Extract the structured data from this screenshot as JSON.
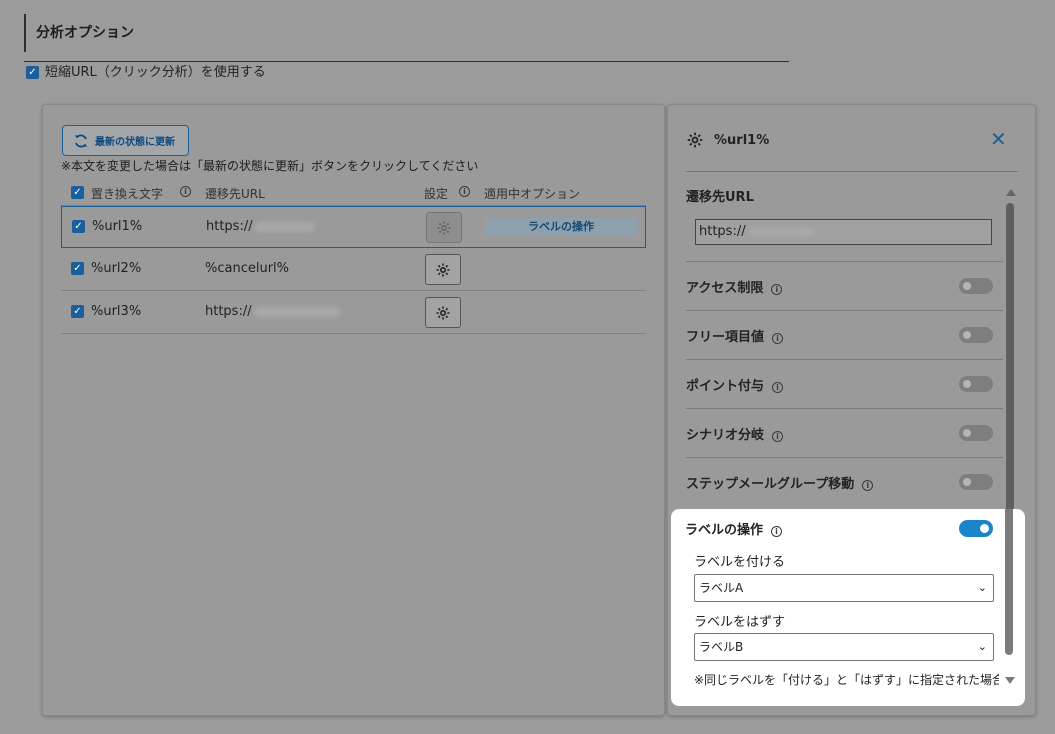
{
  "section": {
    "title": "分析オプション"
  },
  "short_url": {
    "label": "短縮URL（クリック分析）を使用する",
    "checked": true
  },
  "left_panel": {
    "refresh_label": "最新の状態に更新",
    "note": "※本文を変更した場合は「最新の状態に更新」ボタンをクリックしてください",
    "columns": {
      "var": "置き換え文字",
      "dest": "遷移先URL",
      "settings": "設定",
      "options": "適用中オプション"
    },
    "rows": [
      {
        "var": "%url1%",
        "url": "https://",
        "option": "ラベルの操作"
      },
      {
        "var": "%url2%",
        "url": "%cancelurl%",
        "option": ""
      },
      {
        "var": "%url3%",
        "url": "https://",
        "option": ""
      }
    ]
  },
  "right_panel": {
    "title": "%url1%",
    "close": "✕",
    "dest_label": "遷移先URL",
    "dest_value": "https://",
    "options": [
      {
        "label": "アクセス制限",
        "enabled": false
      },
      {
        "label": "フリー項目値",
        "enabled": false
      },
      {
        "label": "ポイント付与",
        "enabled": false
      },
      {
        "label": "シナリオ分岐",
        "enabled": false
      },
      {
        "label": "ステップメールグループ移動",
        "enabled": false
      }
    ],
    "label_op": {
      "label": "ラベルの操作",
      "enabled": true,
      "add_label": "ラベルを付ける",
      "add_value": "ラベルA",
      "remove_label": "ラベルをはずす",
      "remove_value": "ラベルB",
      "note": "※同じラベルを「付ける」と「はずす」に指定された場合"
    }
  },
  "icons": {
    "info": "i",
    "check": "✓",
    "chevron": "⌄"
  },
  "colors": {
    "accent": "#1a5f9c",
    "toggle_on": "#1a86c9"
  }
}
